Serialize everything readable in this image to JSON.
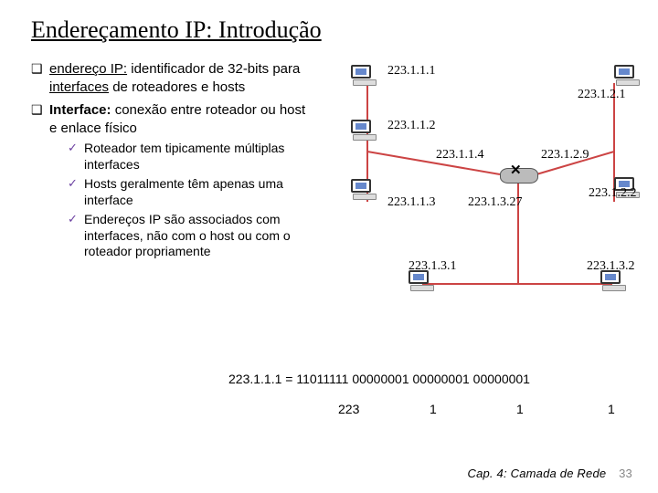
{
  "title": "Endereçamento IP: Introdução",
  "bullets": {
    "b1_pre": "endereço IP:",
    "b1_rest": " identificador de 32-bits para ",
    "b1_u": "interfaces",
    "b1_tail": " de roteadores e hosts",
    "b2_pre": "Interface:",
    "b2_rest": " conexão entre roteador ou host e enlace físico",
    "s1": "Roteador tem tipicamente múltiplas  interfaces",
    "s2": "Hosts geralmente têm apenas uma interface",
    "s3": "Endereços IP são associados com interfaces, não com o host ou com o roteador propriamente"
  },
  "ips": {
    "a1": "223.1.1.1",
    "a2": "223.1.1.2",
    "a3": "223.1.1.3",
    "a4": "223.1.1.4",
    "b1": "223.1.2.1",
    "b2": "223.1.2.2",
    "b9": "223.1.2.9",
    "c1": "223.1.3.1",
    "c2": "223.1.3.2",
    "c27": "223.1.3.27"
  },
  "binary": {
    "line": "223.1.1.1 = 11011111 00000001 00000001 00000001",
    "d1": "223",
    "d2": "1",
    "d3": "1",
    "d4": "1"
  },
  "footer": {
    "text": "Cap. 4: Camada de Rede",
    "page": "33"
  }
}
